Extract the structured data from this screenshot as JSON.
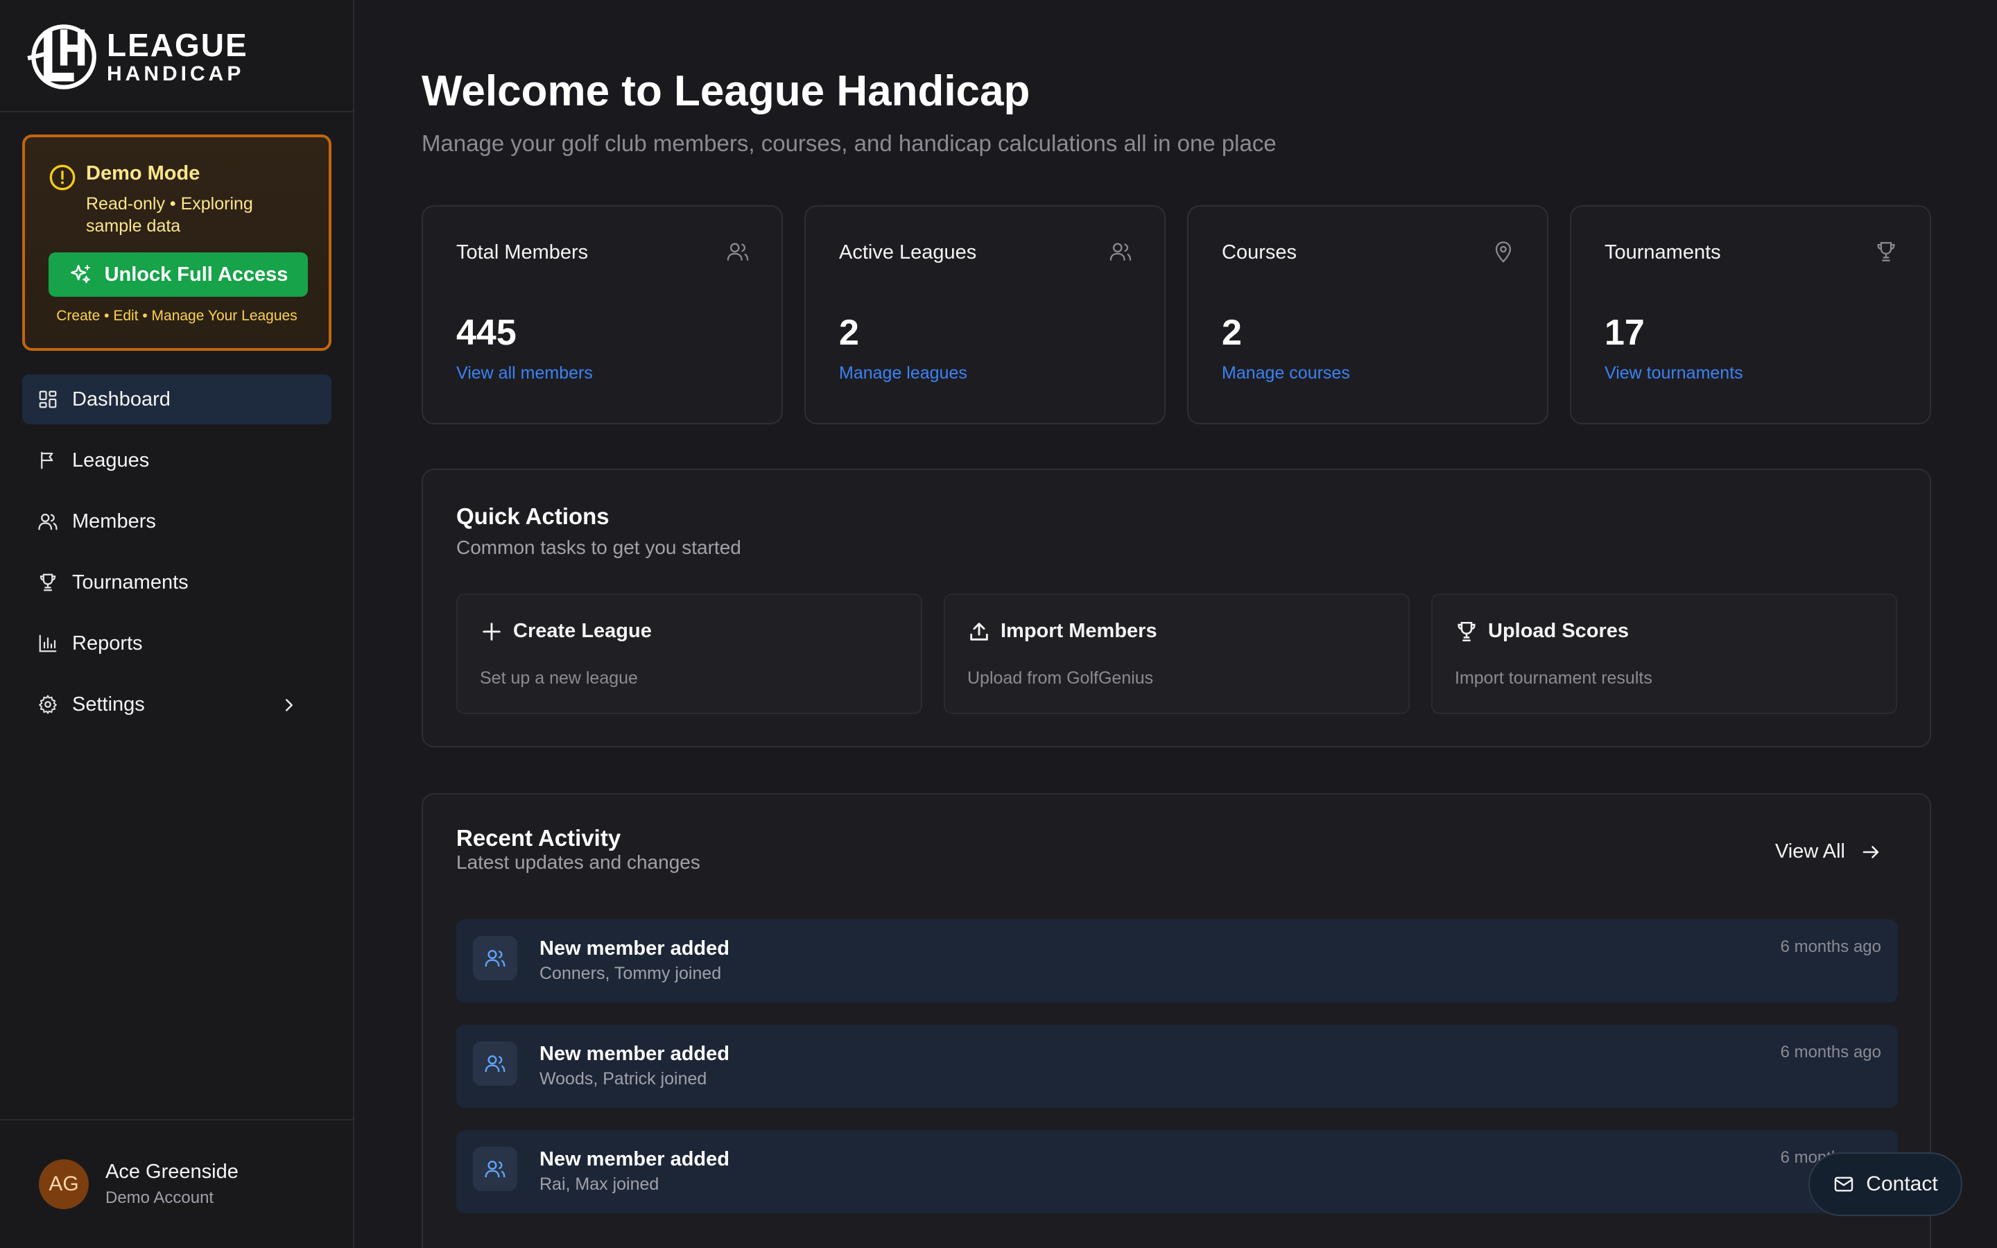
{
  "brand": {
    "line1": "LEAGUE",
    "line2": "HANDICAP"
  },
  "demo": {
    "title": "Demo Mode",
    "subtitle": "Read-only • Exploring sample data",
    "unlock_label": "Unlock Full Access",
    "note": "Create • Edit • Manage Your Leagues"
  },
  "nav": {
    "items": [
      {
        "label": "Dashboard",
        "icon": "dashboard-icon",
        "active": true
      },
      {
        "label": "Leagues",
        "icon": "flag-icon"
      },
      {
        "label": "Members",
        "icon": "users-icon"
      },
      {
        "label": "Tournaments",
        "icon": "trophy-icon"
      },
      {
        "label": "Reports",
        "icon": "bar-chart-icon"
      },
      {
        "label": "Settings",
        "icon": "gear-icon"
      }
    ]
  },
  "user": {
    "initials": "AG",
    "name": "Ace Greenside",
    "role": "Demo Account"
  },
  "header": {
    "title": "Welcome to League Handicap",
    "subtitle": "Manage your golf club members, courses, and handicap calculations all in one place"
  },
  "stats": [
    {
      "label": "Total Members",
      "value": "445",
      "link": "View all members",
      "icon": "users-icon"
    },
    {
      "label": "Active Leagues",
      "value": "2",
      "link": "Manage leagues",
      "icon": "users-icon"
    },
    {
      "label": "Courses",
      "value": "2",
      "link": "Manage courses",
      "icon": "map-pin-icon"
    },
    {
      "label": "Tournaments",
      "value": "17",
      "link": "View tournaments",
      "icon": "trophy-icon"
    }
  ],
  "quick_actions": {
    "title": "Quick Actions",
    "subtitle": "Common tasks to get you started",
    "items": [
      {
        "title": "Create League",
        "subtitle": "Set up a new league",
        "icon": "plus-icon"
      },
      {
        "title": "Import Members",
        "subtitle": "Upload from GolfGenius",
        "icon": "upload-icon"
      },
      {
        "title": "Upload Scores",
        "subtitle": "Import tournament results",
        "icon": "trophy-icon"
      }
    ]
  },
  "recent_activity": {
    "title": "Recent Activity",
    "subtitle": "Latest updates and changes",
    "view_all": "View All",
    "items": [
      {
        "title": "New member added",
        "subtitle": "Conners, Tommy joined",
        "time": "6 months ago"
      },
      {
        "title": "New member added",
        "subtitle": "Woods, Patrick joined",
        "time": "6 months ago"
      },
      {
        "title": "New member added",
        "subtitle": "Rai, Max joined",
        "time": "6 months ago"
      }
    ]
  },
  "contact": {
    "label": "Contact"
  },
  "colors": {
    "background": "#1a1a1e",
    "sidebar": "#19191c",
    "accent_blue": "#3b82f6",
    "demo_border": "#c2650f",
    "demo_text": "#fde68a",
    "unlock_green": "#16a34a",
    "activity_row": "#1c2637"
  }
}
